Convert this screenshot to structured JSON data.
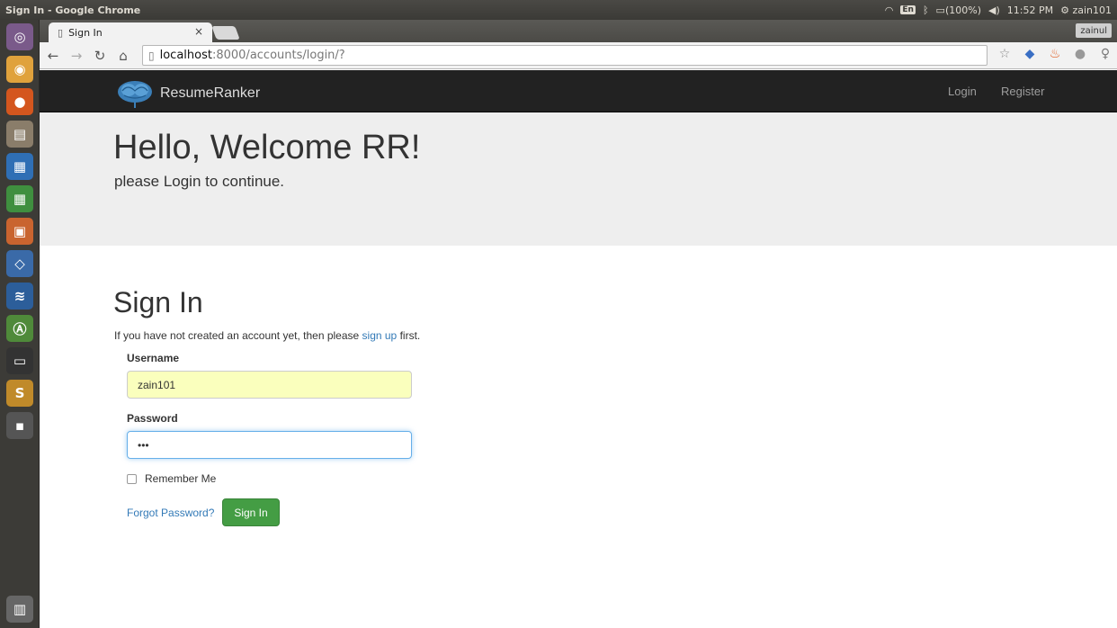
{
  "window": {
    "title": "Sign In - Google Chrome"
  },
  "tray": {
    "input_method": "En",
    "battery": "(100%)",
    "time": "11:52 PM",
    "user": "zain101"
  },
  "tabs": [
    {
      "label": "Sign In",
      "close": "×"
    }
  ],
  "profile": {
    "name": "zainul"
  },
  "address_bar": {
    "host": "localhost",
    "path": ":8000/accounts/login/?"
  },
  "site": {
    "brand": "ResumeRanker",
    "nav": {
      "login": "Login",
      "register": "Register"
    }
  },
  "jumbotron": {
    "title": "Hello, Welcome RR!",
    "subtitle": "please Login to continue."
  },
  "signin": {
    "title": "Sign In",
    "note_before": "If you have not created an account yet, then please ",
    "note_link": "sign up",
    "note_after": " first.",
    "username_label": "Username",
    "username_value": "zain101",
    "password_label": "Password",
    "password_value": "•••",
    "remember_label": "Remember Me",
    "remember_checked": false,
    "forgot_label": "Forgot Password?",
    "submit_label": "Sign In"
  },
  "colors": {
    "nav_bg": "#222222",
    "jumbotron_bg": "#eeeeee",
    "link": "#337ab7",
    "button": "#449d44",
    "autofill": "#faffbd"
  }
}
